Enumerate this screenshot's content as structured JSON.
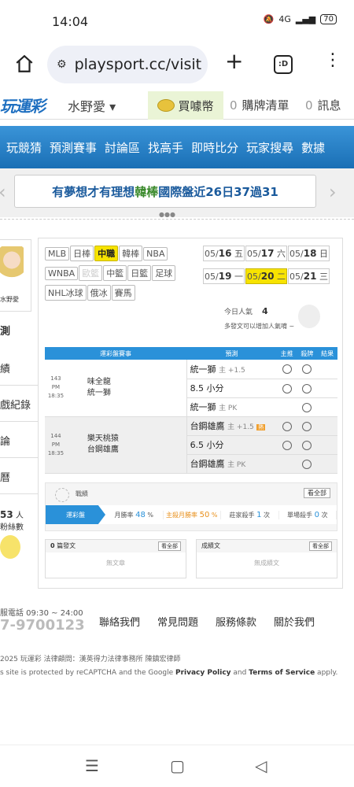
{
  "status": {
    "time": "14:04",
    "battery": "70",
    "net": "4G"
  },
  "browser": {
    "url": "playsport.cc/visit",
    "tabs_label": ":D"
  },
  "topnav": {
    "logo": "玩運彩",
    "user": "水野愛 ▾",
    "coin": "買噱幣",
    "buylist_count": "0",
    "buylist": "購牌清單",
    "msg_count": "0",
    "msg": "訊息"
  },
  "mainnav": [
    "玩競猜",
    "預測賽事",
    "討論區",
    "找高手",
    "即時比分",
    "玩家搜尋",
    "數據"
  ],
  "banner": {
    "text1": "有夢想才有理想 ",
    "team": "韓棒",
    "text2": " 國際盤近26日37過31"
  },
  "sidebar": {
    "name": "水野愛",
    "active": "測",
    "items": [
      "績",
      "戲紀錄",
      "論",
      "曆"
    ],
    "fans_count": "53",
    "fans_unit": "人",
    "fans_sub": "粉絲數"
  },
  "leagues": [
    {
      "label": "MLB"
    },
    {
      "label": "日棒"
    },
    {
      "label": "中職",
      "sel": true
    },
    {
      "label": "韓棒"
    },
    {
      "label": "NBA"
    },
    {
      "label": "WNBA"
    },
    {
      "label": "歐籃",
      "dis": true
    },
    {
      "label": "中籃"
    },
    {
      "label": "日籃"
    },
    {
      "label": "足球"
    },
    {
      "label": "NHL冰球"
    },
    {
      "label": "俄冰"
    },
    {
      "label": "賽馬"
    }
  ],
  "dates": [
    {
      "d": "05/",
      "b": "16",
      "w": " 五"
    },
    {
      "d": "05/",
      "b": "17",
      "w": " 六"
    },
    {
      "d": "05/",
      "b": "18",
      "w": " 日"
    },
    {
      "d": "05/",
      "b": "19",
      "w": " 一"
    },
    {
      "d": "05/",
      "b": "20",
      "w": " 二",
      "sel": true
    },
    {
      "d": "05/",
      "b": "21",
      "w": " 三"
    }
  ],
  "popular": {
    "label": "今日人氣",
    "value": "4",
    "sub": "多發文可以增加人氣唷 ~"
  },
  "table": {
    "h1": "運彩盤賽事",
    "h2": "預測",
    "h3": "主推",
    "h4": "殺牌",
    "h5": "結果"
  },
  "games": [
    {
      "num": "143",
      "time": "PM 18:35",
      "away": "味全龍",
      "home": "統一獅",
      "preds": [
        {
          "t": "統一獅",
          "s": "主 +1.5",
          "r": [
            true,
            true
          ]
        },
        {
          "t": "8.5 小分",
          "s": "",
          "r": [
            true,
            true
          ]
        },
        {
          "t": "統一獅",
          "s": "主 PK",
          "r": [
            false,
            true
          ]
        }
      ]
    },
    {
      "num": "144",
      "time": "PM 18:35",
      "away": "樂天桃猿",
      "home": "台鋼雄鷹",
      "preds": [
        {
          "t": "台鋼雄鷹",
          "s": "主 +1.5",
          "hot": "熱",
          "r": [
            true,
            true
          ]
        },
        {
          "t": "6.5 小分",
          "s": "",
          "r": [
            true,
            true
          ]
        },
        {
          "t": "台鋼雄鷹",
          "s": "主 PK",
          "r": [
            false,
            true
          ]
        }
      ]
    }
  ],
  "stats": {
    "label": "戰績",
    "all": "看全部",
    "tag": "運彩盤",
    "month_label": "月勝率",
    "month_val": "48",
    "pct": "%",
    "home_label": "主殺月勝率",
    "home_val": "50",
    "streak_label": "莊家殺手",
    "streak_val": "1",
    "streak_unit": "次",
    "single_label": "單場殺手",
    "single_val": "0",
    "single_unit": "次"
  },
  "panels": {
    "left_count": "0",
    "left": "篇發文",
    "left_btn": "看全部",
    "left_empty": "無文章",
    "right": "成績文",
    "right_btn": "看全部",
    "right_empty": "無成績文"
  },
  "footer": {
    "hours": "服電話 09:30 ~ 24:00",
    "phone": "7-9700123",
    "links": [
      "聯絡我們",
      "常見問題",
      "服務條款",
      "關於我們"
    ],
    "copy": "2025 玩運彩 法律顧問：漢英得力法律事務所 陳鎮宏律師",
    "recap1": "s site is protected by reCAPTCHA and the Google ",
    "pp": "Privacy Policy",
    "and": " and ",
    "tos": "Terms of Service",
    "apply": " apply."
  }
}
